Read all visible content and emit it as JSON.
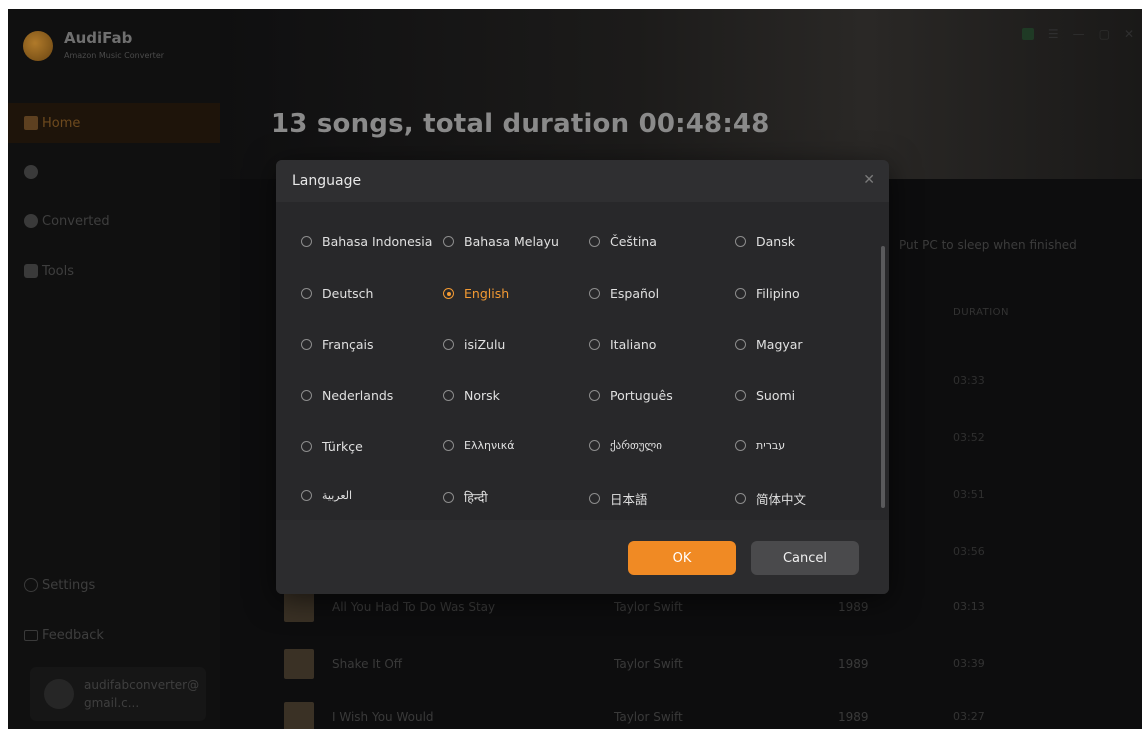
{
  "app": {
    "name": "AudiFab",
    "subtitle": "Amazon Music Converter"
  },
  "sidebar": {
    "items": [
      {
        "label": "Home",
        "icon": "home-icon",
        "active": true
      },
      {
        "label": "",
        "icon": "music-icon"
      },
      {
        "label": "Converted",
        "icon": "clock-icon"
      },
      {
        "label": "Tools",
        "icon": "toolbox-icon"
      },
      {
        "label": "Settings",
        "icon": "gear-icon"
      },
      {
        "label": "Feedback",
        "icon": "mail-icon"
      }
    ],
    "user_email": "audifabconverter@gmail.c..."
  },
  "main": {
    "title": "13 songs, total duration 00:48:48",
    "sleep_option": "Put PC to sleep when finished",
    "duration_header": "DURATION",
    "durations_partial": [
      "03:33",
      "03:52",
      "03:51",
      "03:56"
    ],
    "tracks": [
      {
        "title": "All You Had To Do Was Stay",
        "artist": "Taylor Swift",
        "album": "1989",
        "duration": "03:13"
      },
      {
        "title": "Shake It Off",
        "artist": "Taylor Swift",
        "album": "1989",
        "duration": "03:39"
      },
      {
        "title": "I Wish You Would",
        "artist": "Taylor Swift",
        "album": "1989",
        "duration": "03:27"
      }
    ]
  },
  "dialog": {
    "title": "Language",
    "close_icon": "close-icon",
    "selected": "English",
    "languages": [
      [
        "Bahasa Indonesia",
        "Bahasa Melayu",
        "Čeština",
        "Dansk"
      ],
      [
        "Deutsch",
        "English",
        "Español",
        "Filipino"
      ],
      [
        "Français",
        "isiZulu",
        "Italiano",
        "Magyar"
      ],
      [
        "Nederlands",
        "Norsk",
        "Português",
        "Suomi"
      ],
      [
        "Türkçe",
        "Ελληνικά",
        "ქართული",
        "עברית"
      ],
      [
        "العربية",
        "हिन्दी",
        "日本語",
        "简体中文"
      ]
    ],
    "ok_label": "OK",
    "cancel_label": "Cancel"
  },
  "colors": {
    "accent": "#f08a24",
    "dialog_bg": "#2c2c2e",
    "cancel_bg": "#4a4a4c"
  }
}
